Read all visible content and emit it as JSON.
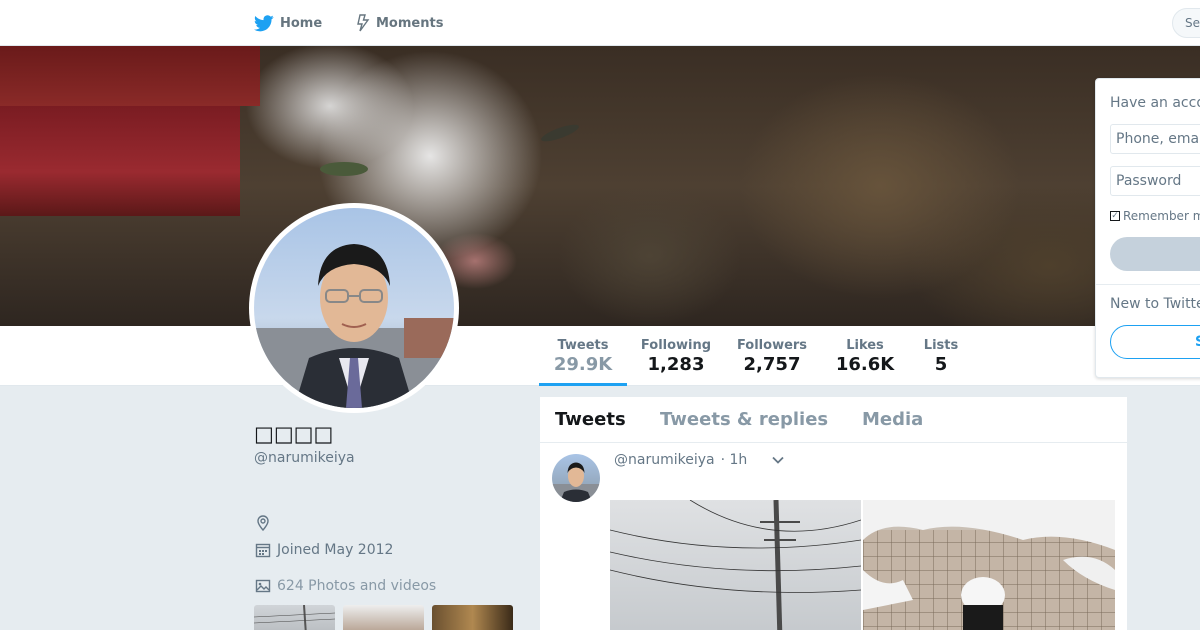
{
  "nav": {
    "home_label": "Home",
    "moments_label": "Moments",
    "search_placeholder": "Se",
    "have_account_hint": "H"
  },
  "profile": {
    "display_name": "□□□□",
    "screen_name": "@narumikeiya",
    "joined": "Joined May 2012",
    "photos_videos": "624 Photos and videos"
  },
  "stats": [
    {
      "label": "Tweets",
      "value": "29.9K",
      "active": true
    },
    {
      "label": "Following",
      "value": "1,283"
    },
    {
      "label": "Followers",
      "value": "2,757"
    },
    {
      "label": "Likes",
      "value": "16.6K"
    },
    {
      "label": "Lists",
      "value": "5"
    }
  ],
  "timeline": {
    "tabs": [
      "Tweets",
      "Tweets & replies",
      "Media"
    ],
    "tweet": {
      "handle": "@narumikeiya",
      "time": "· 1h"
    }
  },
  "login": {
    "title": "Have an acco",
    "phone_placeholder": "Phone, emai",
    "password_placeholder": "Password",
    "remember": "Remember m",
    "new_title": "New to Twitte",
    "signup_label": "S"
  },
  "colors": {
    "accent": "#1da1f2",
    "background": "#e6ecf0",
    "text_secondary": "#657786"
  },
  "icons": {
    "home": "twitter-bird-icon",
    "moments": "lightning-icon",
    "location": "location-pin-icon",
    "calendar": "calendar-icon",
    "photos": "image-icon",
    "caret": "chevron-down-icon"
  }
}
